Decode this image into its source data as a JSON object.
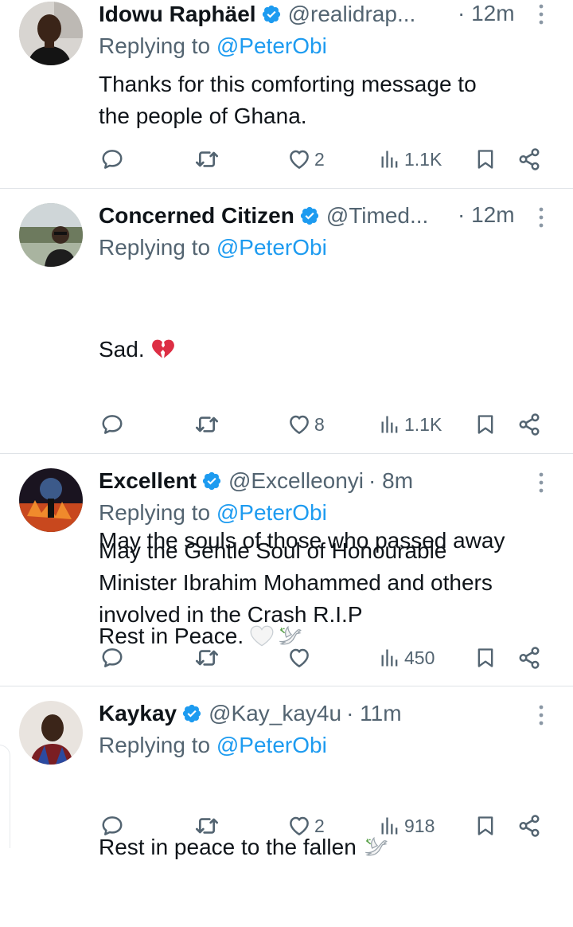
{
  "tweets": [
    {
      "name": "Idowu Raphäel",
      "handle": "@realidrap...",
      "time": "· 12m",
      "replying_prefix": "Replying to",
      "replying_to": "@PeterObi",
      "text": "Thanks for this comforting message to\nthe people of Ghana.",
      "likes": "2",
      "views": "1.1K"
    },
    {
      "name": "Concerned Citizen",
      "handle": "@Timed...",
      "time": "· 12m",
      "replying_prefix": "Replying to",
      "replying_to": "@PeterObi",
      "text_line1": "Sad.",
      "text_line2": "May the souls of those who passed away",
      "text_line3": "Rest in Peace.",
      "likes": "8",
      "views": "1.1K"
    },
    {
      "name": "Excellent",
      "handle": "@Excelleonyi",
      "time": "· 8m",
      "replying_prefix": "Replying to",
      "replying_to": "@PeterObi",
      "text": "May the Gentle Soul of Honourable\nMinister Ibrahim Mohammed and others\ninvolved in the Crash R.I.P",
      "likes": "",
      "views": "450"
    },
    {
      "name": "Kaykay",
      "handle": "@Kay_kay4u",
      "time": "· 11m",
      "replying_prefix": "Replying to",
      "replying_to": "@PeterObi",
      "text": "Rest in peace to the fallen",
      "likes": "2",
      "views": "918"
    }
  ],
  "colors": {
    "accent": "#1d9bf0",
    "secondary": "#536471",
    "text": "#0f1419",
    "divider": "#dfe3e7"
  },
  "icons": [
    "verified-badge-icon",
    "more-icon",
    "reply-icon",
    "retweet-icon",
    "like-icon",
    "views-icon",
    "bookmark-icon",
    "share-icon",
    "broken-heart-emoji",
    "white-heart-emoji",
    "dove-emoji"
  ]
}
